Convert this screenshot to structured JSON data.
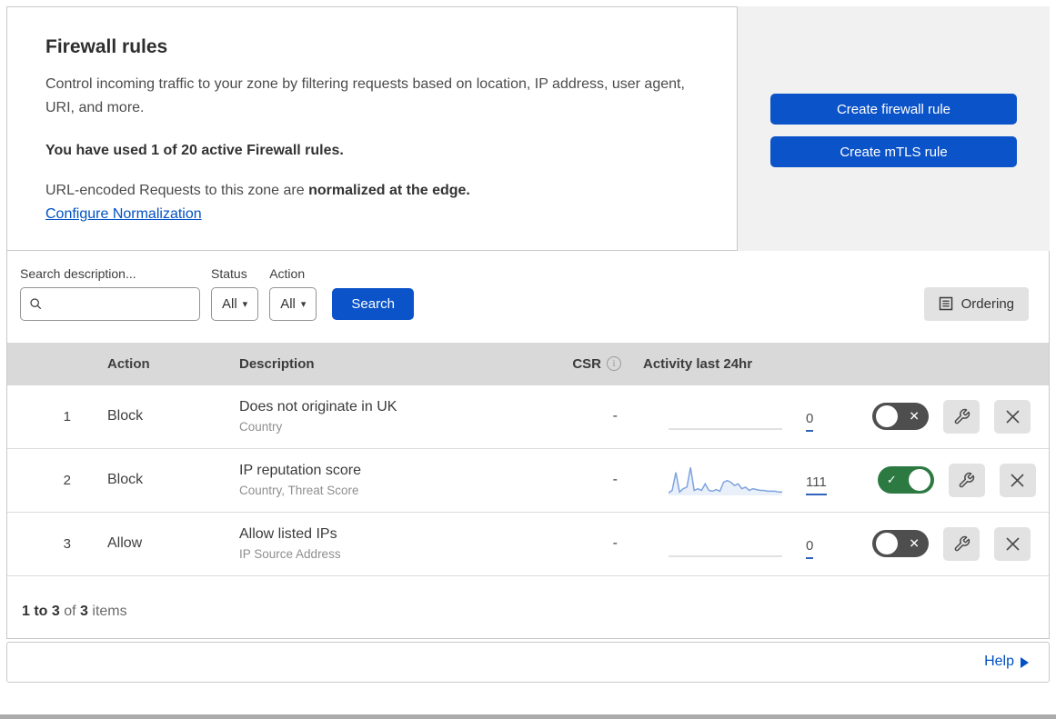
{
  "intro": {
    "title": "Firewall rules",
    "description": "Control incoming traffic to your zone by filtering requests based on location, IP address, user agent, URI, and more.",
    "usage_text": "You have used 1 of 20 active Firewall rules.",
    "normalization_prefix": "URL-encoded Requests to this zone are ",
    "normalization_bold": "normalized at the edge.",
    "normalization_link": "Configure Normalization"
  },
  "actions": {
    "create_firewall_rule": "Create firewall rule",
    "create_mtls_rule": "Create mTLS rule"
  },
  "filters": {
    "search_label": "Search description...",
    "search_value": "",
    "status_label": "Status",
    "status_value": "All",
    "action_label": "Action",
    "action_value": "All",
    "search_button": "Search",
    "ordering_button": "Ordering"
  },
  "table": {
    "headers": {
      "action": "Action",
      "description": "Description",
      "csr": "CSR",
      "activity": "Activity last 24hr"
    },
    "rows": [
      {
        "number": "1",
        "action": "Block",
        "description": "Does not originate in UK",
        "fields": "Country",
        "csr": "-",
        "activity_count": "0",
        "enabled": false
      },
      {
        "number": "2",
        "action": "Block",
        "description": "IP reputation score",
        "fields": "Country, Threat Score",
        "csr": "-",
        "activity_count": "111",
        "enabled": true,
        "sparkline": [
          6,
          15,
          81,
          9,
          21,
          27,
          99,
          15,
          21,
          15,
          39,
          15,
          12,
          18,
          12,
          45,
          51,
          45,
          33,
          39,
          21,
          27,
          15,
          21,
          18,
          15,
          15,
          12,
          12,
          12,
          9,
          9
        ]
      },
      {
        "number": "3",
        "action": "Allow",
        "description": "Allow listed IPs",
        "fields": "IP Source Address",
        "csr": "-",
        "activity_count": "0",
        "enabled": false
      }
    ]
  },
  "footer": {
    "count_bold1": "1 to 3",
    "count_mid": " of ",
    "count_bold2": "3",
    "count_end": " items"
  },
  "help": {
    "label": "Help"
  },
  "colors": {
    "accent_blue": "#0b53c8",
    "link_blue": "#0051c3",
    "toggle_on_green": "#2c7a42",
    "toggle_off_gray": "#4e4e4e",
    "sparkline": "#7fa3e0",
    "sparkline_fill": "rgba(127,163,224,0.16)",
    "flat_line_gray": "#c3c3c3"
  }
}
